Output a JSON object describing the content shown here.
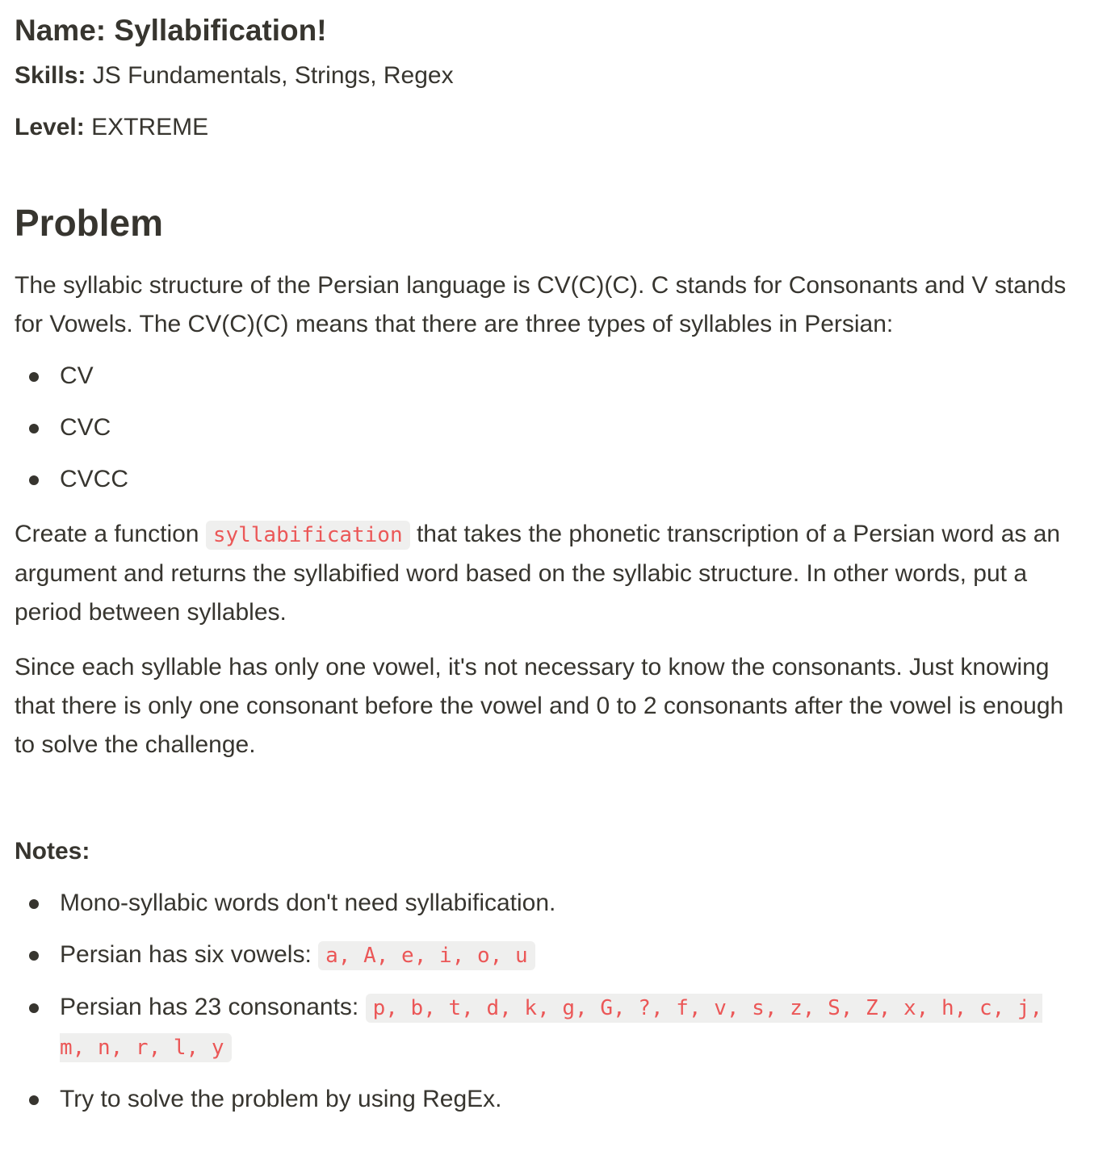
{
  "header": {
    "name_label": "Name:",
    "name_value": "Syllabification!",
    "skills_label": "Skills:",
    "skills_value": "JS Fundamentals, Strings, Regex",
    "level_label": "Level:",
    "level_value": "EXTREME"
  },
  "problem": {
    "heading": "Problem",
    "intro": "The syllabic structure of the Persian language is CV(C)(C). C stands for Consonants and V stands for Vowels. The CV(C)(C) means that there are three types of syllables in Persian:",
    "syllable_types": [
      "CV",
      "CVC",
      "CVCC"
    ],
    "task_before": "Create a function ",
    "task_code": "syllabification",
    "task_after": " that takes the phonetic transcription of a Persian word as an argument and returns the syllabified word based on the syllabic structure. In other words, put a period between syllables.",
    "hint": "Since each syllable has only one vowel, it's not necessary to know the consonants. Just knowing that there is only one consonant before the vowel and 0 to 2 consonants after the vowel is enough to solve the challenge."
  },
  "notes": {
    "label": "Notes:",
    "item1": "Mono-syllabic words don't need syllabification.",
    "item2_text": "Persian has six vowels: ",
    "item2_code": "a, A, e, i, o, u",
    "item3_text": "Persian has 23 consonants: ",
    "item3_code": "p, b, t, d, k, g, G, ?, f, v, s, z, S, Z, x, h, c, j, m, n, r, l, y",
    "item4": "Try to solve the problem by using RegEx."
  }
}
